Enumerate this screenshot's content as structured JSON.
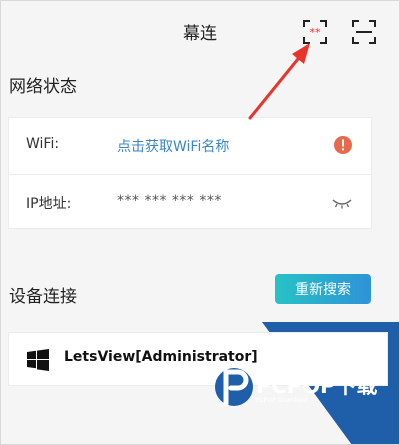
{
  "header": {
    "title": "幕连",
    "scan_badge": "**"
  },
  "network": {
    "section_title": "网络状态",
    "wifi_label": "WiFi:",
    "wifi_value": "点击获取WiFi名称",
    "ip_label": "IP地址:",
    "ip_value": "*** *** *** ***"
  },
  "devices": {
    "section_title": "设备连接",
    "research_label": "重新搜索",
    "items": [
      {
        "name": "LetsView[Administrator]"
      }
    ]
  },
  "watermark": {
    "brand": "PCPOP下载",
    "sub": "PCPOP Download"
  },
  "colors": {
    "accent_blue": "#3a86c8",
    "warning_red": "#e8684a",
    "annotation_red": "#e8352b",
    "watermark_blue": "#1f5ea8"
  }
}
